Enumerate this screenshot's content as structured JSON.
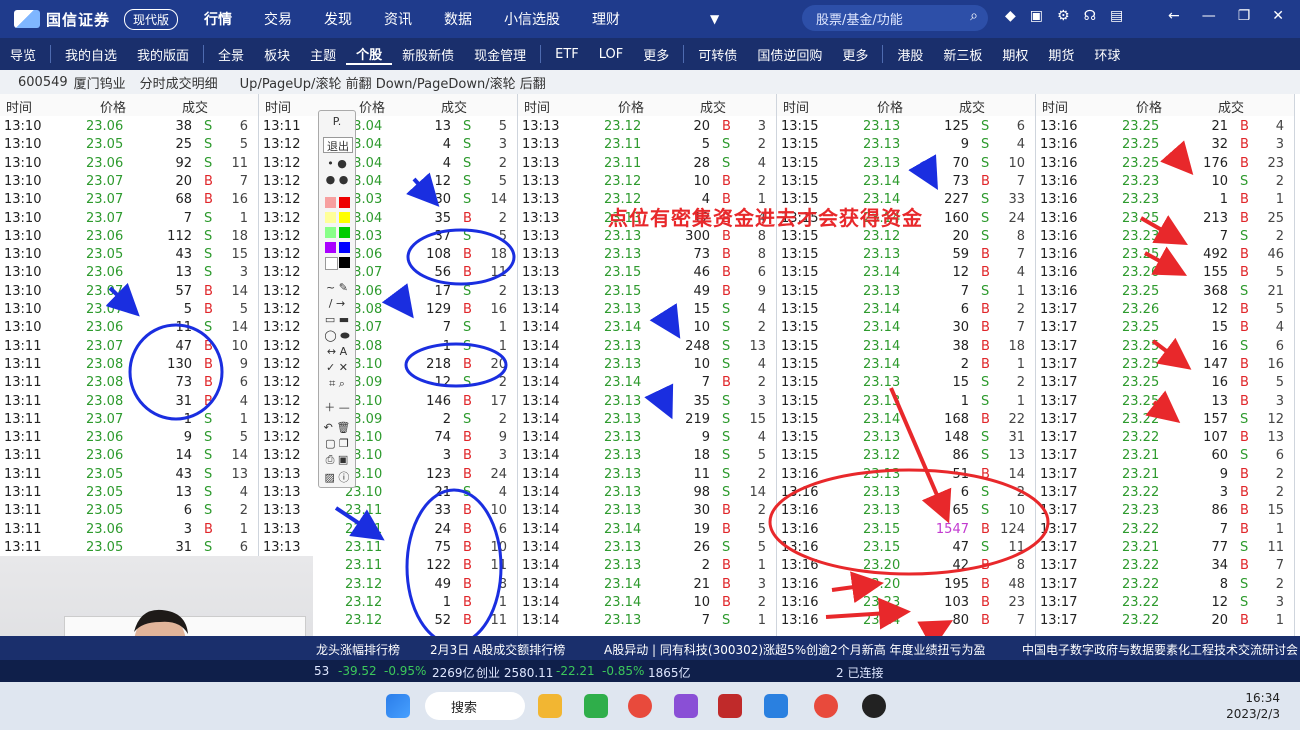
{
  "brand": {
    "name": "国信证券",
    "sub": "GUOSEN SECURITIES",
    "version": "现代版"
  },
  "topnav": [
    "行情",
    "交易",
    "发现",
    "资讯",
    "数据",
    "小信选股",
    "理财"
  ],
  "search": {
    "placeholder": "股票/基金/功能"
  },
  "menubar": [
    "导览",
    "我的自选",
    "我的版面",
    "全景",
    "板块",
    "主题",
    "个股",
    "新股新债",
    "现金管理",
    "ETF",
    "LOF",
    "更多",
    "可转债",
    "国债逆回购",
    "更多",
    "港股",
    "新三板",
    "期权",
    "期货",
    "环球"
  ],
  "info": {
    "code": "600549",
    "name": "厦门钨业",
    "title": "分时成交明细",
    "hint": "Up/PageUp/滚轮 前翻 Down/PageDown/滚轮 后翻"
  },
  "headers": {
    "time": "时间",
    "price": "价格",
    "volume": "成交"
  },
  "columns": [
    {
      "rows": [
        [
          "13:10",
          "23.06",
          "38",
          "S",
          "6"
        ],
        [
          "13:10",
          "23.05",
          "25",
          "S",
          "5"
        ],
        [
          "13:10",
          "23.06",
          "92",
          "S",
          "11"
        ],
        [
          "13:10",
          "23.07",
          "20",
          "B",
          "7"
        ],
        [
          "13:10",
          "23.07",
          "68",
          "B",
          "16"
        ],
        [
          "13:10",
          "23.07",
          "7",
          "S",
          "1"
        ],
        [
          "13:10",
          "23.06",
          "112",
          "S",
          "18"
        ],
        [
          "13:10",
          "23.05",
          "43",
          "S",
          "15"
        ],
        [
          "13:10",
          "23.06",
          "13",
          "S",
          "3"
        ],
        [
          "13:10",
          "23.07",
          "57",
          "B",
          "14"
        ],
        [
          "13:10",
          "23.07",
          "5",
          "B",
          "5"
        ],
        [
          "13:10",
          "23.06",
          "11",
          "S",
          "14"
        ],
        [
          "13:11",
          "23.07",
          "47",
          "B",
          "10"
        ],
        [
          "13:11",
          "23.08",
          "130",
          "B",
          "9"
        ],
        [
          "13:11",
          "23.08",
          "73",
          "B",
          "6"
        ],
        [
          "13:11",
          "23.08",
          "31",
          "B",
          "4"
        ],
        [
          "13:11",
          "23.07",
          "1",
          "S",
          "1"
        ],
        [
          "13:11",
          "23.06",
          "9",
          "S",
          "5"
        ],
        [
          "13:11",
          "23.06",
          "14",
          "S",
          "14"
        ],
        [
          "13:11",
          "23.05",
          "43",
          "S",
          "13"
        ],
        [
          "13:11",
          "23.05",
          "13",
          "S",
          "4"
        ],
        [
          "13:11",
          "23.05",
          "6",
          "S",
          "2"
        ],
        [
          "13:11",
          "23.06",
          "3",
          "B",
          "1"
        ],
        [
          "13:11",
          "23.05",
          "31",
          "S",
          "6"
        ]
      ]
    },
    {
      "rows": [
        [
          "13:11",
          "23.04",
          "13",
          "S",
          "5"
        ],
        [
          "13:12",
          "23.04",
          "4",
          "S",
          "3"
        ],
        [
          "13:12",
          "23.04",
          "4",
          "S",
          "2"
        ],
        [
          "13:12",
          "23.04",
          "12",
          "S",
          "5"
        ],
        [
          "13:12",
          "23.03",
          "30",
          "S",
          "14"
        ],
        [
          "13:12",
          "23.04",
          "35",
          "B",
          "2"
        ],
        [
          "13:12",
          "23.03",
          "37",
          "S",
          "5"
        ],
        [
          "13:12",
          "23.06",
          "108",
          "B",
          "18"
        ],
        [
          "13:12",
          "23.07",
          "56",
          "B",
          "11"
        ],
        [
          "13:12",
          "23.06",
          "17",
          "S",
          "2"
        ],
        [
          "13:12",
          "23.08",
          "129",
          "B",
          "16"
        ],
        [
          "13:12",
          "23.07",
          "7",
          "S",
          "1"
        ],
        [
          "13:12",
          "23.08",
          "1",
          "S",
          "1"
        ],
        [
          "13:12",
          "23.10",
          "218",
          "B",
          "20"
        ],
        [
          "13:12",
          "23.09",
          "12",
          "S",
          "2"
        ],
        [
          "13:12",
          "23.10",
          "146",
          "B",
          "17"
        ],
        [
          "13:12",
          "23.09",
          "2",
          "S",
          "2"
        ],
        [
          "13:12",
          "23.10",
          "74",
          "B",
          "9"
        ],
        [
          "13:12",
          "23.10",
          "3",
          "B",
          "3"
        ],
        [
          "13:13",
          "23.10",
          "123",
          "B",
          "24"
        ],
        [
          "13:13",
          "23.10",
          "21",
          "S",
          "4"
        ],
        [
          "13:13",
          "23.11",
          "33",
          "B",
          "10"
        ],
        [
          "13:13",
          "23.11",
          "24",
          "B",
          "6"
        ],
        [
          "13:13",
          "23.11",
          "75",
          "B",
          "10"
        ],
        [
          "13:13",
          "23.11",
          "122",
          "B",
          "11"
        ],
        [
          "13:13",
          "23.12",
          "49",
          "B",
          "8"
        ],
        [
          "13:13",
          "23.12",
          "1",
          "B",
          "1"
        ],
        [
          "13:13",
          "23.12",
          "52",
          "B",
          "11"
        ]
      ]
    },
    {
      "rows": [
        [
          "13:13",
          "23.12",
          "20",
          "B",
          "3"
        ],
        [
          "13:13",
          "23.11",
          "5",
          "S",
          "2"
        ],
        [
          "13:13",
          "23.11",
          "28",
          "S",
          "4"
        ],
        [
          "13:13",
          "23.12",
          "10",
          "B",
          "2"
        ],
        [
          "13:13",
          "23.12",
          "4",
          "B",
          "1"
        ],
        [
          "13:13",
          "23.13",
          "12",
          "B",
          "4"
        ],
        [
          "13:13",
          "23.13",
          "300",
          "B",
          "8"
        ],
        [
          "13:13",
          "23.13",
          "73",
          "B",
          "8"
        ],
        [
          "13:13",
          "23.15",
          "46",
          "B",
          "6"
        ],
        [
          "13:13",
          "23.15",
          "49",
          "B",
          "9"
        ],
        [
          "13:14",
          "23.13",
          "15",
          "S",
          "4"
        ],
        [
          "13:14",
          "23.14",
          "10",
          "S",
          "2"
        ],
        [
          "13:14",
          "23.13",
          "248",
          "S",
          "13"
        ],
        [
          "13:14",
          "23.13",
          "10",
          "S",
          "4"
        ],
        [
          "13:14",
          "23.14",
          "7",
          "B",
          "2"
        ],
        [
          "13:14",
          "23.13",
          "35",
          "S",
          "3"
        ],
        [
          "13:14",
          "23.13",
          "219",
          "S",
          "15"
        ],
        [
          "13:14",
          "23.13",
          "9",
          "S",
          "4"
        ],
        [
          "13:14",
          "23.13",
          "18",
          "S",
          "5"
        ],
        [
          "13:14",
          "23.13",
          "11",
          "S",
          "2"
        ],
        [
          "13:14",
          "23.13",
          "98",
          "S",
          "14"
        ],
        [
          "13:14",
          "23.13",
          "30",
          "B",
          "2"
        ],
        [
          "13:14",
          "23.14",
          "19",
          "B",
          "5"
        ],
        [
          "13:14",
          "23.13",
          "26",
          "S",
          "5"
        ],
        [
          "13:14",
          "23.13",
          "2",
          "B",
          "1"
        ],
        [
          "13:14",
          "23.14",
          "21",
          "B",
          "3"
        ],
        [
          "13:14",
          "23.14",
          "10",
          "B",
          "2"
        ],
        [
          "13:14",
          "23.13",
          "7",
          "S",
          "1"
        ]
      ]
    },
    {
      "rows": [
        [
          "13:15",
          "23.13",
          "125",
          "S",
          "6"
        ],
        [
          "13:15",
          "23.13",
          "9",
          "S",
          "4"
        ],
        [
          "13:15",
          "23.13",
          "70",
          "S",
          "10"
        ],
        [
          "13:15",
          "23.14",
          "73",
          "B",
          "7"
        ],
        [
          "13:15",
          "23.14",
          "227",
          "S",
          "33"
        ],
        [
          "13:15",
          "23.14",
          "160",
          "S",
          "24"
        ],
        [
          "13:15",
          "23.12",
          "20",
          "S",
          "8"
        ],
        [
          "13:15",
          "23.13",
          "59",
          "B",
          "7"
        ],
        [
          "13:15",
          "23.14",
          "12",
          "B",
          "4"
        ],
        [
          "13:15",
          "23.13",
          "7",
          "S",
          "1"
        ],
        [
          "13:15",
          "23.14",
          "6",
          "B",
          "2"
        ],
        [
          "13:15",
          "23.14",
          "30",
          "B",
          "7"
        ],
        [
          "13:15",
          "23.14",
          "38",
          "B",
          "18"
        ],
        [
          "13:15",
          "23.14",
          "2",
          "B",
          "1"
        ],
        [
          "13:15",
          "23.13",
          "15",
          "S",
          "2"
        ],
        [
          "13:15",
          "23.13",
          "1",
          "S",
          "1"
        ],
        [
          "13:15",
          "23.14",
          "168",
          "B",
          "22"
        ],
        [
          "13:15",
          "23.13",
          "148",
          "S",
          "31"
        ],
        [
          "13:15",
          "23.12",
          "86",
          "S",
          "13"
        ],
        [
          "13:16",
          "23.13",
          "51",
          "B",
          "14"
        ],
        [
          "13:16",
          "23.13",
          "6",
          "S",
          "2"
        ],
        [
          "13:16",
          "23.13",
          "65",
          "S",
          "10"
        ],
        [
          "13:16",
          "23.15",
          "1547",
          "B",
          "124"
        ],
        [
          "13:16",
          "23.15",
          "47",
          "S",
          "11"
        ],
        [
          "13:16",
          "23.20",
          "42",
          "B",
          "8"
        ],
        [
          "13:16",
          "23.20",
          "195",
          "B",
          "48"
        ],
        [
          "13:16",
          "23.23",
          "103",
          "B",
          "23"
        ],
        [
          "13:16",
          "23.24",
          "80",
          "B",
          "7"
        ]
      ]
    },
    {
      "rows": [
        [
          "13:16",
          "23.25",
          "21",
          "B",
          "4"
        ],
        [
          "13:16",
          "23.25",
          "32",
          "B",
          "3"
        ],
        [
          "13:16",
          "23.25",
          "176",
          "B",
          "23"
        ],
        [
          "13:16",
          "23.23",
          "10",
          "S",
          "2"
        ],
        [
          "13:16",
          "23.23",
          "1",
          "B",
          "1"
        ],
        [
          "13:16",
          "23.25",
          "213",
          "B",
          "25"
        ],
        [
          "13:16",
          "23.23",
          "7",
          "S",
          "2"
        ],
        [
          "13:16",
          "23.25",
          "492",
          "B",
          "46"
        ],
        [
          "13:16",
          "23.26",
          "155",
          "B",
          "5"
        ],
        [
          "13:16",
          "23.25",
          "368",
          "S",
          "21"
        ],
        [
          "13:17",
          "23.26",
          "12",
          "B",
          "5"
        ],
        [
          "13:17",
          "23.25",
          "15",
          "B",
          "4"
        ],
        [
          "13:17",
          "23.25",
          "16",
          "S",
          "6"
        ],
        [
          "13:17",
          "23.25",
          "147",
          "B",
          "16"
        ],
        [
          "13:17",
          "23.25",
          "16",
          "B",
          "5"
        ],
        [
          "13:17",
          "23.25",
          "13",
          "B",
          "3"
        ],
        [
          "13:17",
          "23.22",
          "157",
          "S",
          "12"
        ],
        [
          "13:17",
          "23.22",
          "107",
          "B",
          "13"
        ],
        [
          "13:17",
          "23.21",
          "60",
          "S",
          "6"
        ],
        [
          "13:17",
          "23.21",
          "9",
          "B",
          "2"
        ],
        [
          "13:17",
          "23.22",
          "3",
          "B",
          "2"
        ],
        [
          "13:17",
          "23.23",
          "86",
          "B",
          "15"
        ],
        [
          "13:17",
          "23.22",
          "7",
          "B",
          "1"
        ],
        [
          "13:17",
          "23.21",
          "77",
          "S",
          "11"
        ],
        [
          "13:17",
          "23.22",
          "34",
          "B",
          "7"
        ],
        [
          "13:17",
          "23.22",
          "8",
          "S",
          "2"
        ],
        [
          "13:17",
          "23.22",
          "12",
          "S",
          "3"
        ],
        [
          "13:17",
          "23.22",
          "20",
          "B",
          "1"
        ]
      ]
    }
  ],
  "annotation": "点位有密集资金进去才会获得资金",
  "ticker": {
    "left": "龙头涨幅排行榜",
    "mid": "2月3日 A股成交额排行榜",
    "news": "A股异动 | 同有科技(300302)涨超5%创逾2个月新高 年度业绩扭亏为盈",
    "right": "中国电子数字政府与数据要素化工程技术交流研讨会"
  },
  "status": {
    "a": "53",
    "b": "-39.52",
    "c": "-0.95%",
    "d": "2269亿",
    "e": "创业 2580.11",
    "f": "-22.21",
    "g": "-0.85%",
    "h": "1865亿",
    "conn": "2 已连接"
  },
  "taskbar": {
    "search": "搜索",
    "time": "16:34",
    "date": "2023/2/3"
  },
  "toolbox": {
    "exit": "退出",
    "p": "P."
  }
}
